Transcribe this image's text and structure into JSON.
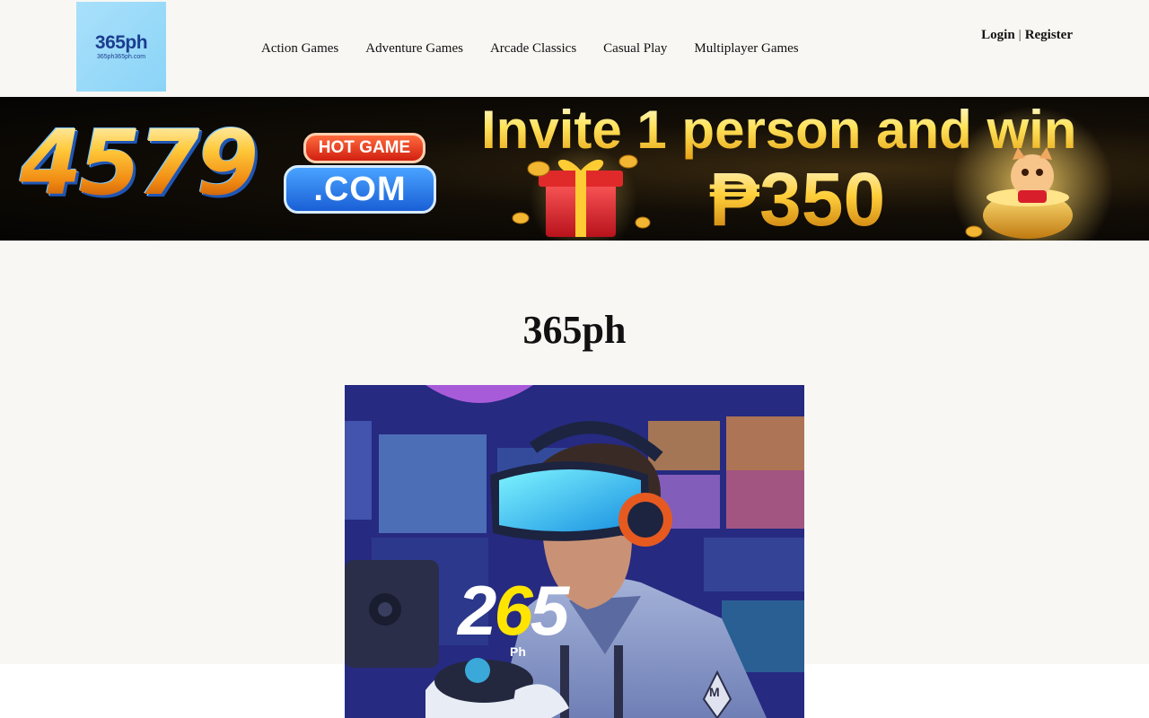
{
  "site": {
    "logo_main": "365ph",
    "logo_sub": "365ph365ph.com"
  },
  "nav": {
    "items": [
      {
        "label": "Action Games"
      },
      {
        "label": "Adventure Games"
      },
      {
        "label": "Arcade Classics"
      },
      {
        "label": "Casual Play"
      },
      {
        "label": "Multiplayer Games"
      }
    ]
  },
  "auth": {
    "login": "Login",
    "separator": "|",
    "register": "Register"
  },
  "banner": {
    "number": "4579",
    "hot_label": "HOT GAME",
    "domain": ".COM",
    "headline": "Invite 1 person and win",
    "amount": "₱350"
  },
  "main": {
    "title": "365ph"
  },
  "hero": {
    "number_left": "2",
    "number_mid": "6",
    "number_right": "5",
    "suffix": "Ph",
    "shirt_mark": "M"
  },
  "colors": {
    "page_bg": "#f8f7f4",
    "logo_bg": "#a9e0fb",
    "banner_gold": "#ffcf3a",
    "hero_bg": "#2a2a7e"
  }
}
